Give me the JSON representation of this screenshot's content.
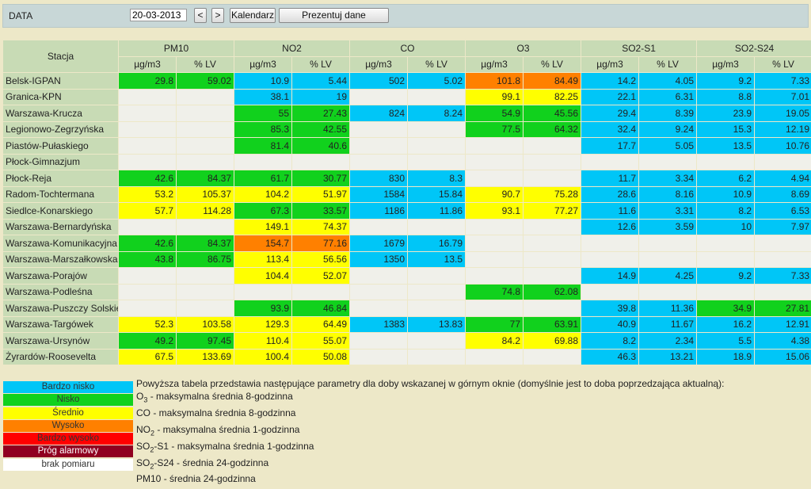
{
  "toolbar": {
    "date_label": "DATA",
    "date_value": "20-03-2013",
    "prev_label": "<",
    "next_label": ">",
    "calendar_label": "Kalendarz",
    "present_label": "Prezentuj dane"
  },
  "table": {
    "station_header": "Stacja",
    "groups": [
      "PM10",
      "NO2",
      "CO",
      "O3",
      "SO2-S1",
      "SO2-S24"
    ],
    "units": [
      "µg/m3",
      "% LV"
    ],
    "rows": [
      {
        "name": "Belsk-IGPAN",
        "cells": [
          [
            "29.8",
            "n"
          ],
          [
            "59.02",
            "n"
          ],
          [
            "10.9",
            "bn"
          ],
          [
            "5.44",
            "bn"
          ],
          [
            "502",
            "bn"
          ],
          [
            "5.02",
            "bn"
          ],
          [
            "101.8",
            "w"
          ],
          [
            "84.49",
            "w"
          ],
          [
            "14.2",
            "bn"
          ],
          [
            "4.05",
            "bn"
          ],
          [
            "9.2",
            "bn"
          ],
          [
            "7.33",
            "bn"
          ]
        ]
      },
      {
        "name": "Granica-KPN",
        "cells": [
          [
            "",
            "x"
          ],
          [
            "",
            "x"
          ],
          [
            "38.1",
            "bn"
          ],
          [
            "19",
            "bn"
          ],
          [
            "",
            "x"
          ],
          [
            "",
            "x"
          ],
          [
            "99.1",
            "s"
          ],
          [
            "82.25",
            "s"
          ],
          [
            "22.1",
            "bn"
          ],
          [
            "6.31",
            "bn"
          ],
          [
            "8.8",
            "bn"
          ],
          [
            "7.01",
            "bn"
          ]
        ]
      },
      {
        "name": "Warszawa-Krucza",
        "cells": [
          [
            "",
            "x"
          ],
          [
            "",
            "x"
          ],
          [
            "55",
            "n"
          ],
          [
            "27.43",
            "n"
          ],
          [
            "824",
            "bn"
          ],
          [
            "8.24",
            "bn"
          ],
          [
            "54.9",
            "n"
          ],
          [
            "45.56",
            "n"
          ],
          [
            "29.4",
            "bn"
          ],
          [
            "8.39",
            "bn"
          ],
          [
            "23.9",
            "bn"
          ],
          [
            "19.05",
            "bn"
          ]
        ]
      },
      {
        "name": "Legionowo-Zegrzyńska",
        "cells": [
          [
            "",
            "x"
          ],
          [
            "",
            "x"
          ],
          [
            "85.3",
            "n"
          ],
          [
            "42.55",
            "n"
          ],
          [
            "",
            "x"
          ],
          [
            "",
            "x"
          ],
          [
            "77.5",
            "n"
          ],
          [
            "64.32",
            "n"
          ],
          [
            "32.4",
            "bn"
          ],
          [
            "9.24",
            "bn"
          ],
          [
            "15.3",
            "bn"
          ],
          [
            "12.19",
            "bn"
          ]
        ]
      },
      {
        "name": "Piastów-Pułaskiego",
        "cells": [
          [
            "",
            "x"
          ],
          [
            "",
            "x"
          ],
          [
            "81.4",
            "n"
          ],
          [
            "40.6",
            "n"
          ],
          [
            "",
            "x"
          ],
          [
            "",
            "x"
          ],
          [
            "",
            "x"
          ],
          [
            "",
            "x"
          ],
          [
            "17.7",
            "bn"
          ],
          [
            "5.05",
            "bn"
          ],
          [
            "13.5",
            "bn"
          ],
          [
            "10.76",
            "bn"
          ]
        ]
      },
      {
        "name": "Płock-Gimnazjum",
        "cells": [
          [
            "",
            "x"
          ],
          [
            "",
            "x"
          ],
          [
            "",
            "x"
          ],
          [
            "",
            "x"
          ],
          [
            "",
            "x"
          ],
          [
            "",
            "x"
          ],
          [
            "",
            "x"
          ],
          [
            "",
            "x"
          ],
          [
            "",
            "x"
          ],
          [
            "",
            "x"
          ],
          [
            "",
            "x"
          ],
          [
            "",
            "x"
          ]
        ]
      },
      {
        "name": "Płock-Reja",
        "cells": [
          [
            "42.6",
            "n"
          ],
          [
            "84.37",
            "n"
          ],
          [
            "61.7",
            "n"
          ],
          [
            "30.77",
            "n"
          ],
          [
            "830",
            "bn"
          ],
          [
            "8.3",
            "bn"
          ],
          [
            "",
            "x"
          ],
          [
            "",
            "x"
          ],
          [
            "11.7",
            "bn"
          ],
          [
            "3.34",
            "bn"
          ],
          [
            "6.2",
            "bn"
          ],
          [
            "4.94",
            "bn"
          ]
        ]
      },
      {
        "name": "Radom-Tochtermana",
        "cells": [
          [
            "53.2",
            "s"
          ],
          [
            "105.37",
            "s"
          ],
          [
            "104.2",
            "s"
          ],
          [
            "51.97",
            "s"
          ],
          [
            "1584",
            "bn"
          ],
          [
            "15.84",
            "bn"
          ],
          [
            "90.7",
            "s"
          ],
          [
            "75.28",
            "s"
          ],
          [
            "28.6",
            "bn"
          ],
          [
            "8.16",
            "bn"
          ],
          [
            "10.9",
            "bn"
          ],
          [
            "8.69",
            "bn"
          ]
        ]
      },
      {
        "name": "Siedlce-Konarskiego",
        "cells": [
          [
            "57.7",
            "s"
          ],
          [
            "114.28",
            "s"
          ],
          [
            "67.3",
            "n"
          ],
          [
            "33.57",
            "n"
          ],
          [
            "1186",
            "bn"
          ],
          [
            "11.86",
            "bn"
          ],
          [
            "93.1",
            "s"
          ],
          [
            "77.27",
            "s"
          ],
          [
            "11.6",
            "bn"
          ],
          [
            "3.31",
            "bn"
          ],
          [
            "8.2",
            "bn"
          ],
          [
            "6.53",
            "bn"
          ]
        ]
      },
      {
        "name": "Warszawa-Bernardyńska",
        "cells": [
          [
            "",
            "x"
          ],
          [
            "",
            "x"
          ],
          [
            "149.1",
            "s"
          ],
          [
            "74.37",
            "s"
          ],
          [
            "",
            "x"
          ],
          [
            "",
            "x"
          ],
          [
            "",
            "x"
          ],
          [
            "",
            "x"
          ],
          [
            "12.6",
            "bn"
          ],
          [
            "3.59",
            "bn"
          ],
          [
            "10",
            "bn"
          ],
          [
            "7.97",
            "bn"
          ]
        ]
      },
      {
        "name": "Warszawa-Komunikacyjna",
        "cells": [
          [
            "42.6",
            "n"
          ],
          [
            "84.37",
            "n"
          ],
          [
            "154.7",
            "w"
          ],
          [
            "77.16",
            "w"
          ],
          [
            "1679",
            "bn"
          ],
          [
            "16.79",
            "bn"
          ],
          [
            "",
            "x"
          ],
          [
            "",
            "x"
          ],
          [
            "",
            "x"
          ],
          [
            "",
            "x"
          ],
          [
            "",
            "x"
          ],
          [
            "",
            "x"
          ]
        ]
      },
      {
        "name": "Warszawa-Marszałkowska",
        "cells": [
          [
            "43.8",
            "n"
          ],
          [
            "86.75",
            "n"
          ],
          [
            "113.4",
            "s"
          ],
          [
            "56.56",
            "s"
          ],
          [
            "1350",
            "bn"
          ],
          [
            "13.5",
            "bn"
          ],
          [
            "",
            "x"
          ],
          [
            "",
            "x"
          ],
          [
            "",
            "x"
          ],
          [
            "",
            "x"
          ],
          [
            "",
            "x"
          ],
          [
            "",
            "x"
          ]
        ]
      },
      {
        "name": "Warszawa-Porajów",
        "cells": [
          [
            "",
            "x"
          ],
          [
            "",
            "x"
          ],
          [
            "104.4",
            "s"
          ],
          [
            "52.07",
            "s"
          ],
          [
            "",
            "x"
          ],
          [
            "",
            "x"
          ],
          [
            "",
            "x"
          ],
          [
            "",
            "x"
          ],
          [
            "14.9",
            "bn"
          ],
          [
            "4.25",
            "bn"
          ],
          [
            "9.2",
            "bn"
          ],
          [
            "7.33",
            "bn"
          ]
        ]
      },
      {
        "name": "Warszawa-Podleśna",
        "cells": [
          [
            "",
            "x"
          ],
          [
            "",
            "x"
          ],
          [
            "",
            "x"
          ],
          [
            "",
            "x"
          ],
          [
            "",
            "x"
          ],
          [
            "",
            "x"
          ],
          [
            "74.8",
            "n"
          ],
          [
            "62.08",
            "n"
          ],
          [
            "",
            "x"
          ],
          [
            "",
            "x"
          ],
          [
            "",
            "x"
          ],
          [
            "",
            "x"
          ]
        ]
      },
      {
        "name": "Warszawa-Puszczy Solskiej",
        "cells": [
          [
            "",
            "x"
          ],
          [
            "",
            "x"
          ],
          [
            "93.9",
            "n"
          ],
          [
            "46.84",
            "n"
          ],
          [
            "",
            "x"
          ],
          [
            "",
            "x"
          ],
          [
            "",
            "x"
          ],
          [
            "",
            "x"
          ],
          [
            "39.8",
            "bn"
          ],
          [
            "11.36",
            "bn"
          ],
          [
            "34.9",
            "n"
          ],
          [
            "27.81",
            "n"
          ]
        ]
      },
      {
        "name": "Warszawa-Targówek",
        "cells": [
          [
            "52.3",
            "s"
          ],
          [
            "103.58",
            "s"
          ],
          [
            "129.3",
            "s"
          ],
          [
            "64.49",
            "s"
          ],
          [
            "1383",
            "bn"
          ],
          [
            "13.83",
            "bn"
          ],
          [
            "77",
            "n"
          ],
          [
            "63.91",
            "n"
          ],
          [
            "40.9",
            "bn"
          ],
          [
            "11.67",
            "bn"
          ],
          [
            "16.2",
            "bn"
          ],
          [
            "12.91",
            "bn"
          ]
        ]
      },
      {
        "name": "Warszawa-Ursynów",
        "cells": [
          [
            "49.2",
            "n"
          ],
          [
            "97.45",
            "n"
          ],
          [
            "110.4",
            "s"
          ],
          [
            "55.07",
            "s"
          ],
          [
            "",
            "x"
          ],
          [
            "",
            "x"
          ],
          [
            "84.2",
            "s"
          ],
          [
            "69.88",
            "s"
          ],
          [
            "8.2",
            "bn"
          ],
          [
            "2.34",
            "bn"
          ],
          [
            "5.5",
            "bn"
          ],
          [
            "4.38",
            "bn"
          ]
        ]
      },
      {
        "name": "Żyrardów-Roosevelta",
        "cells": [
          [
            "67.5",
            "s"
          ],
          [
            "133.69",
            "s"
          ],
          [
            "100.4",
            "s"
          ],
          [
            "50.08",
            "s"
          ],
          [
            "",
            "x"
          ],
          [
            "",
            "x"
          ],
          [
            "",
            "x"
          ],
          [
            "",
            "x"
          ],
          [
            "46.3",
            "bn"
          ],
          [
            "13.21",
            "bn"
          ],
          [
            "18.9",
            "bn"
          ],
          [
            "15.06",
            "bn"
          ]
        ]
      }
    ]
  },
  "legend": [
    {
      "label": "Bardzo nisko",
      "color": "#00c6f7",
      "text_color": "#333333"
    },
    {
      "label": "Nisko",
      "color": "#11d11d",
      "text_color": "#333333"
    },
    {
      "label": "Średnio",
      "color": "#ffff00",
      "text_color": "#333333"
    },
    {
      "label": "Wysoko",
      "color": "#ff8000",
      "text_color": "#333333"
    },
    {
      "label": "Bardzo wysoko",
      "color": "#ff0000",
      "text_color": "#333333"
    },
    {
      "label": "Próg alarmowy",
      "color": "#900020",
      "text_color": "#ffffff"
    },
    {
      "label": "brak pomiaru",
      "color": "#ffffff",
      "text_color": "#333333"
    }
  ],
  "notes": {
    "intro": "Powyższa tabela przedstawia następujące parametry dla doby wskazanej w górnym oknie (domyślnie jest to doba poprzedzająca aktualną):",
    "lines": [
      {
        "pre": "O",
        "sub": "3",
        "post": " - maksymalna średnia 8-godzinna"
      },
      {
        "pre": "CO",
        "sub": "",
        "post": " - maksymalna średnia 8-godzinna"
      },
      {
        "pre": "NO",
        "sub": "2",
        "post": " - maksymalna średnia 1-godzinna"
      },
      {
        "pre": "SO",
        "sub": "2",
        "post": "-S1 - maksymalna średnia 1-godzinna"
      },
      {
        "pre": "SO",
        "sub": "2",
        "post": "-S24 - średnia 24-godzinna"
      },
      {
        "pre": "PM10",
        "sub": "",
        "post": " - średnia 24-godzinna"
      }
    ]
  }
}
